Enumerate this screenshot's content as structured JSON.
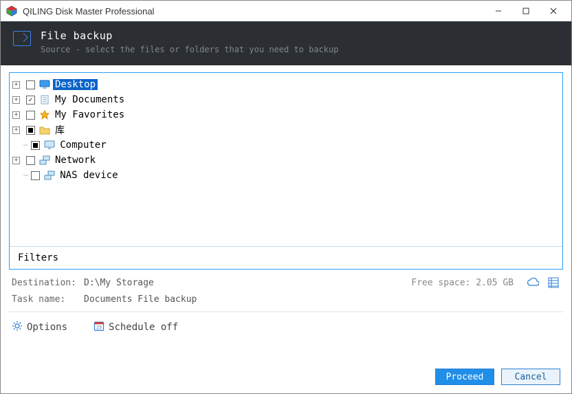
{
  "window": {
    "title": "QILING Disk Master Professional"
  },
  "header": {
    "title": "File backup",
    "subtitle": "Source - select the files or folders that you need to backup"
  },
  "tree": {
    "items": [
      {
        "label": "Desktop",
        "expandable": true,
        "check": "empty",
        "selected": true,
        "icon": "desktop"
      },
      {
        "label": "My Documents",
        "expandable": true,
        "check": "checked",
        "selected": false,
        "icon": "doc"
      },
      {
        "label": "My Favorites",
        "expandable": true,
        "check": "empty",
        "selected": false,
        "icon": "star"
      },
      {
        "label": "库",
        "expandable": true,
        "check": "partial",
        "selected": false,
        "icon": "folder"
      },
      {
        "label": "Computer",
        "expandable": false,
        "check": "partial",
        "selected": false,
        "icon": "monitor"
      },
      {
        "label": "Network",
        "expandable": true,
        "check": "empty",
        "selected": false,
        "icon": "net"
      },
      {
        "label": "NAS device",
        "expandable": false,
        "check": "empty",
        "selected": false,
        "icon": "net"
      }
    ]
  },
  "filters": {
    "label": "Filters"
  },
  "destination": {
    "label": "Destination:",
    "value": "D:\\My Storage",
    "free_label": "Free space: 2.05 GB"
  },
  "task": {
    "label": "Task name:",
    "value": "Documents File backup"
  },
  "options": {
    "options_label": "Options",
    "schedule_label": "Schedule off"
  },
  "footer": {
    "proceed": "Proceed",
    "cancel": "Cancel"
  }
}
